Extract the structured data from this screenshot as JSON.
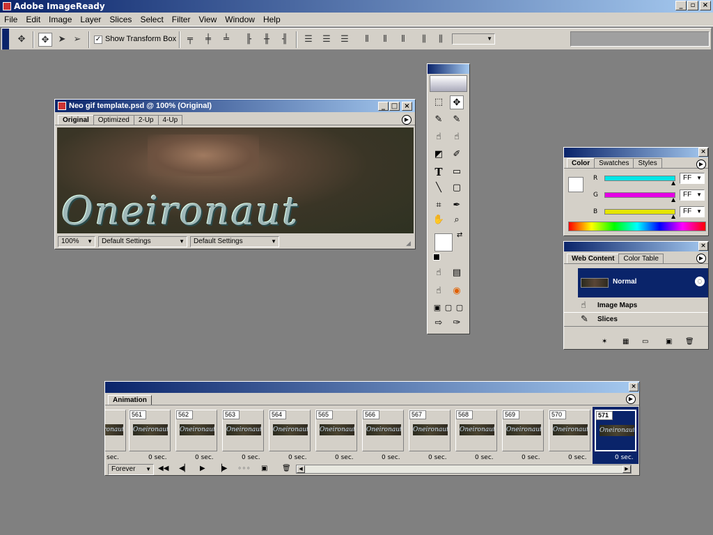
{
  "app": {
    "title": "Adobe ImageReady"
  },
  "menu": [
    "File",
    "Edit",
    "Image",
    "Layer",
    "Slices",
    "Select",
    "Filter",
    "View",
    "Window",
    "Help"
  ],
  "options": {
    "show_transform_box": "Show Transform Box",
    "show_transform_checked": true
  },
  "doc": {
    "title": "Neo gif template.psd @ 100% (Original)",
    "tabs": [
      "Original",
      "Optimized",
      "2-Up",
      "4-Up"
    ],
    "active_tab": "Original",
    "image_text": "Oneironaut",
    "zoom": "100%",
    "setting1": "Default Settings",
    "setting2": "Default Settings"
  },
  "color_panel": {
    "tabs": [
      "Color",
      "Swatches",
      "Styles"
    ],
    "channels": [
      {
        "label": "R",
        "value": "FF",
        "color": "#00e5e5"
      },
      {
        "label": "G",
        "value": "FF",
        "color": "#e500e5"
      },
      {
        "label": "B",
        "value": "FF",
        "color": "#e5e500"
      }
    ]
  },
  "web_panel": {
    "tabs": [
      "Web Content",
      "Color Table"
    ],
    "rows": [
      {
        "label": "Normal",
        "icon": "thumbnail-icon"
      },
      {
        "label": "Image Maps",
        "icon": "hand-icon"
      },
      {
        "label": "Slices",
        "icon": "slice-knife-icon"
      }
    ]
  },
  "animation": {
    "tab": "Animation",
    "loop": "Forever",
    "frames": [
      {
        "num": "561",
        "delay": "0 sec."
      },
      {
        "num": "562",
        "delay": "0 sec."
      },
      {
        "num": "563",
        "delay": "0 sec."
      },
      {
        "num": "564",
        "delay": "0 sec."
      },
      {
        "num": "565",
        "delay": "0 sec."
      },
      {
        "num": "566",
        "delay": "0 sec."
      },
      {
        "num": "567",
        "delay": "0 sec."
      },
      {
        "num": "568",
        "delay": "0 sec."
      },
      {
        "num": "569",
        "delay": "0 sec."
      },
      {
        "num": "570",
        "delay": "0 sec."
      },
      {
        "num": "571",
        "delay": "0 sec."
      }
    ],
    "partial_delay": "sec.",
    "frame_thumb_text": "Oneironaut",
    "selected": "571"
  }
}
